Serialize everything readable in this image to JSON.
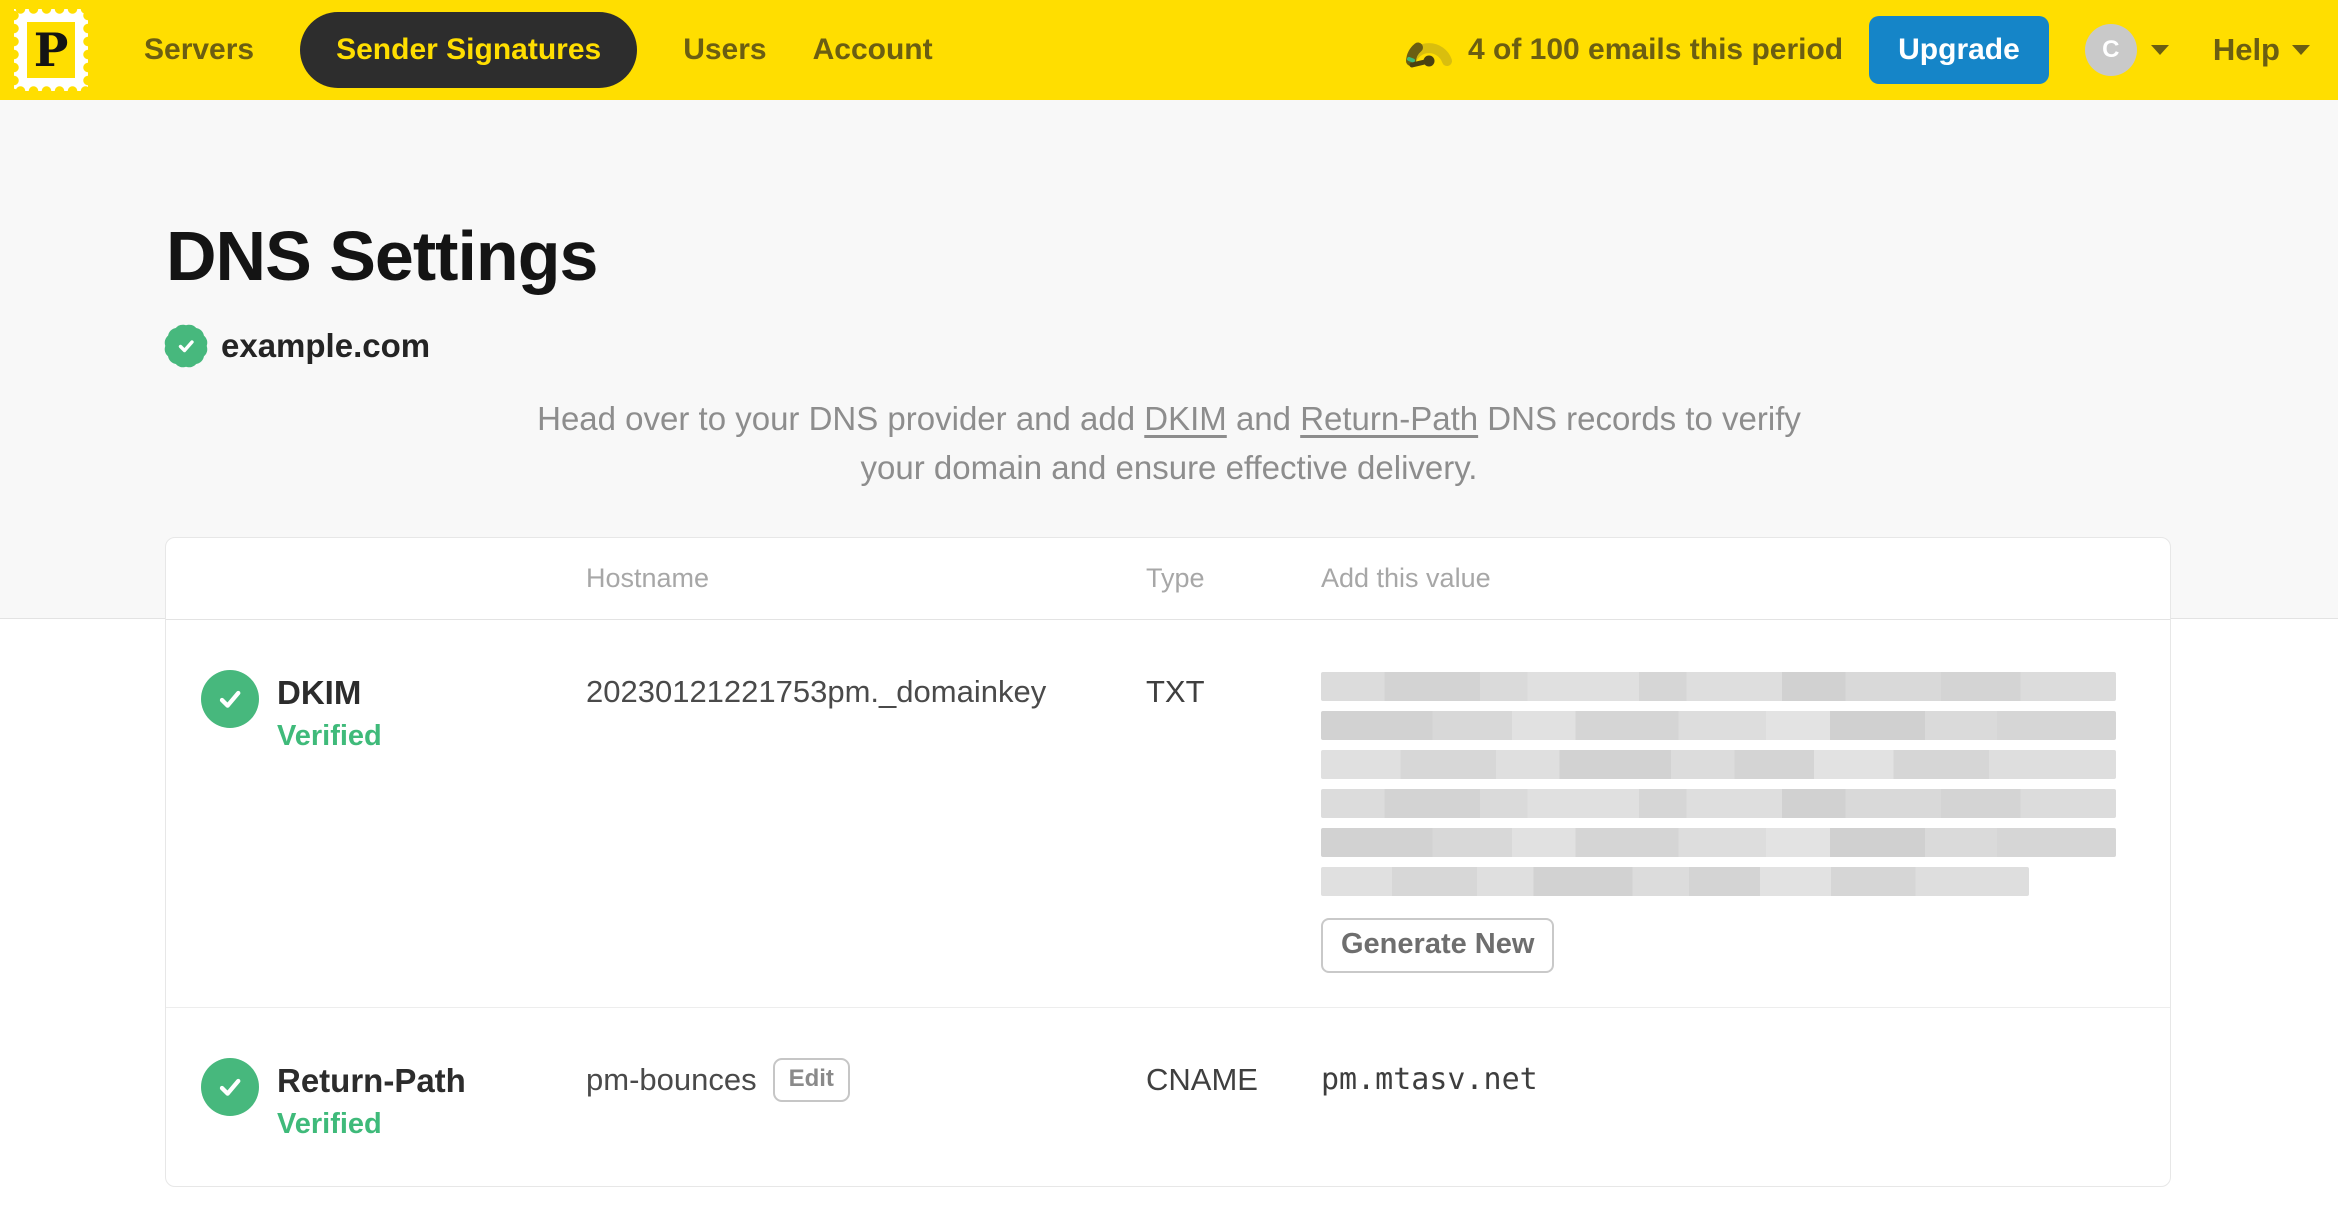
{
  "navbar": {
    "logo_letter": "P",
    "items": [
      {
        "label": "Servers",
        "active": false
      },
      {
        "label": "Sender Signatures",
        "active": true
      },
      {
        "label": "Users",
        "active": false
      },
      {
        "label": "Account",
        "active": false
      }
    ],
    "usage_text": "4 of 100 emails this period",
    "upgrade_label": "Upgrade",
    "avatar_initial": "C",
    "help_label": "Help"
  },
  "page": {
    "title": "DNS Settings",
    "domain": "example.com",
    "intro": {
      "part1": "Head over to your DNS provider and add ",
      "dkim_link": "DKIM",
      "part2": " and ",
      "return_path_link": "Return-Path",
      "part3": " DNS records to verify your domain and ensure effective delivery."
    }
  },
  "table": {
    "headers": {
      "hostname": "Hostname",
      "type": "Type",
      "value": "Add this value"
    },
    "rows": [
      {
        "name": "DKIM",
        "status": "Verified",
        "hostname": "20230121221753pm._domainkey",
        "type": "TXT",
        "value_redacted": true,
        "redacted_lines": 6,
        "action_label": "Generate New"
      },
      {
        "name": "Return-Path",
        "status": "Verified",
        "hostname": "pm-bounces",
        "edit_label": "Edit",
        "type": "CNAME",
        "value": "pm.mtasv.net"
      }
    ]
  },
  "colors": {
    "brand_yellow": "#FFDE00",
    "nav_text": "#6B5E12",
    "active_pill_bg": "#2D2D2D",
    "upgrade_blue": "#1585C8",
    "verified_green": "#47B87D"
  }
}
